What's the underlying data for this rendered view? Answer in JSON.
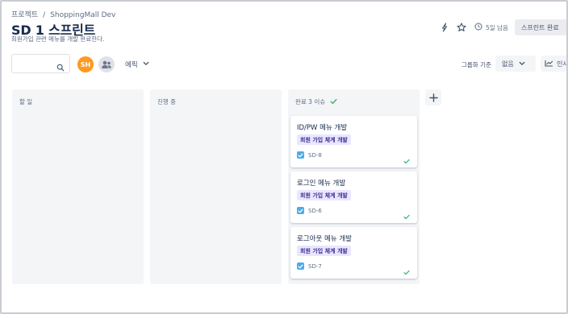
{
  "breadcrumb": {
    "project": "프로젝트",
    "separator": "/",
    "name": "ShoppingMall Dev"
  },
  "header": {
    "title": "SD 1 스프린트",
    "subtitle": "회원가입 관련 메뉴를 개발 완료한다.",
    "days_left": "5일 남음",
    "complete_button": "스프린트 완료"
  },
  "toolbar": {
    "search_placeholder": "",
    "avatar_initials": "SH",
    "epic_label": "에픽",
    "groupby_label": "그룹화 기준",
    "groupby_value": "없음",
    "insight_label": "인사이트"
  },
  "columns": [
    {
      "title": "할 일"
    },
    {
      "title": "진행 중"
    },
    {
      "title": "완료 3 이슈"
    }
  ],
  "cards": [
    {
      "title": "ID/PW 메뉴 개발",
      "epic": "회원 가입 체계 개발",
      "key": "SD-8"
    },
    {
      "title": "로그인 메뉴 개발",
      "epic": "회원 가입 체계 개발",
      "key": "SD-6"
    },
    {
      "title": "로그아웃 메뉴 개발",
      "epic": "회원 가입 체계 개발",
      "key": "SD-7"
    }
  ],
  "colors": {
    "avatar": "#ff991f",
    "epic_bg": "#eae6ff",
    "epic_text": "#403294",
    "done_check": "#36b37e",
    "issue_checkbox": "#4bade8"
  }
}
